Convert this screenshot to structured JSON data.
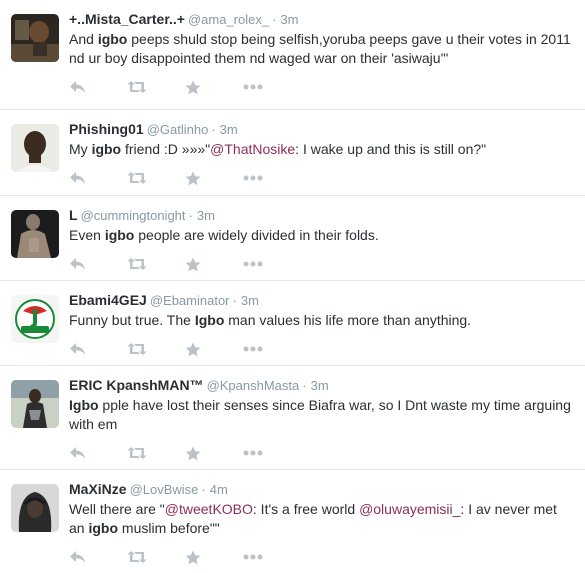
{
  "tweets": [
    {
      "fullname": "+..Mista_Carter..+",
      "username": "@ama_rolex_",
      "separator": "·",
      "time": "3m",
      "segments": [
        {
          "t": "And "
        },
        {
          "t": "igbo",
          "b": true
        },
        {
          "t": " peeps shuld stop being selfish,yoruba peeps gave u their votes in 2011 nd ur boy disappointed them nd waged war on their 'asiwaju'\""
        }
      ],
      "avatar": "avatar-photo-dark"
    },
    {
      "fullname": "Phishing01",
      "username": "@Gatlinho",
      "separator": "·",
      "time": "3m",
      "segments": [
        {
          "t": "My "
        },
        {
          "t": "igbo",
          "b": true
        },
        {
          "t": " friend :D »»»\""
        },
        {
          "t": "@ThatNosike",
          "m": true
        },
        {
          "t": ": I wake up and this is still on?\""
        }
      ],
      "avatar": "avatar-photo-portrait"
    },
    {
      "fullname": "L",
      "username": "@cummingtonight",
      "separator": "·",
      "time": "3m",
      "segments": [
        {
          "t": "Even "
        },
        {
          "t": "igbo",
          "b": true
        },
        {
          "t": " people are widely divided in their folds."
        }
      ],
      "avatar": "avatar-photo-shirtless"
    },
    {
      "fullname": "Ebami4GEJ",
      "username": "@Ebaminator",
      "separator": "·",
      "time": "3m",
      "segments": [
        {
          "t": "Funny but true. The "
        },
        {
          "t": "Igbo",
          "b": true
        },
        {
          "t": " man values his life more than anything."
        }
      ],
      "avatar": "avatar-party-logo"
    },
    {
      "fullname": "ERIC KpanshMAN™",
      "username": "@KpanshMasta",
      "separator": "·",
      "time": "3m",
      "segments": [
        {
          "t": "Igbo",
          "b": true
        },
        {
          "t": " pple have lost their senses since Biafra war, so I Dnt waste my time arguing with em"
        }
      ],
      "avatar": "avatar-photo-outdoor"
    },
    {
      "fullname": "MaXiNze",
      "username": "@LovBwise",
      "separator": "·",
      "time": "4m",
      "segments": [
        {
          "t": "Well there are \""
        },
        {
          "t": "@tweetKOBO",
          "m": true
        },
        {
          "t": ": It's a free world "
        },
        {
          "t": "@oluwayemisii_",
          "m": true
        },
        {
          "t": ": I av never met an "
        },
        {
          "t": "igbo",
          "b": true
        },
        {
          "t": " muslim before\"\""
        }
      ],
      "avatar": "avatar-photo-hoodie"
    }
  ],
  "actions": [
    "reply-icon",
    "retweet-icon",
    "favorite-icon",
    "more-icon"
  ],
  "colors": {
    "icon": "#bbc3c9",
    "mention": "#8e2d5a",
    "meta": "#8899a6",
    "text": "#292f33",
    "divider": "#e1e8ed"
  }
}
